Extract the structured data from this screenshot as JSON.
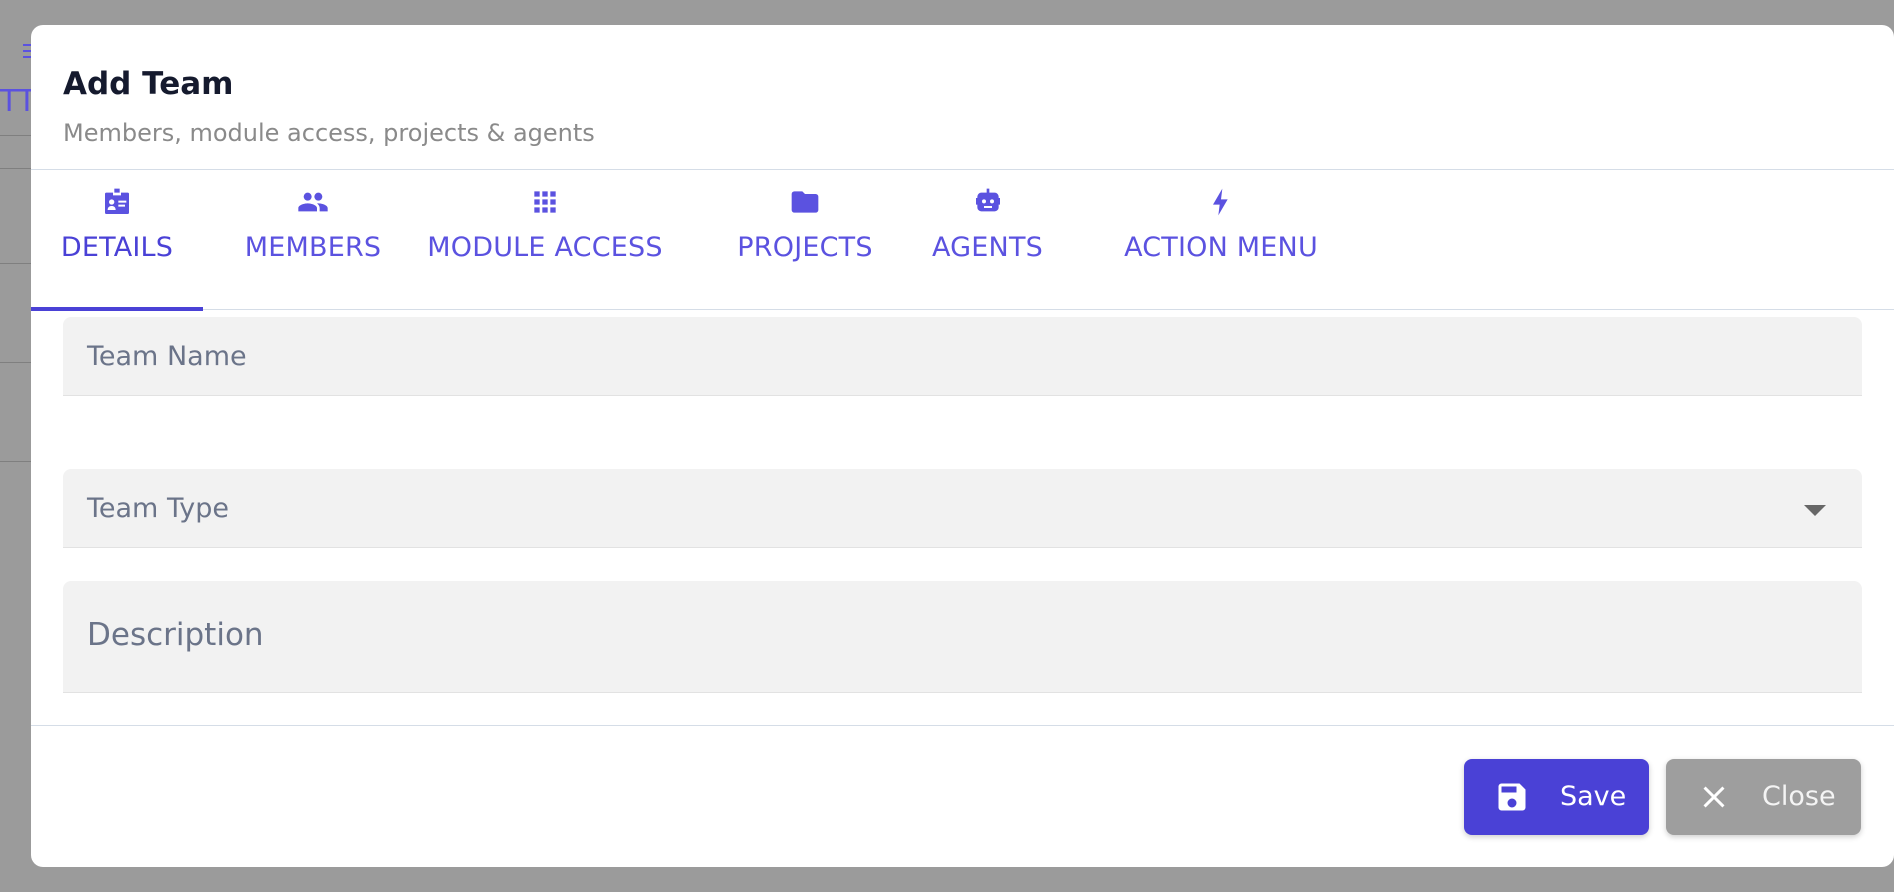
{
  "background": {
    "fragment_text": "TT",
    "fragment_icon": "list-icon"
  },
  "modal": {
    "title": "Add Team",
    "subtitle": "Members, module access, projects & agents"
  },
  "tabs": [
    {
      "label": "DETAILS",
      "icon": "id-badge-icon",
      "active": true
    },
    {
      "label": "MEMBERS",
      "icon": "people-icon",
      "active": false
    },
    {
      "label": "MODULE ACCESS",
      "icon": "apps-grid-icon",
      "active": false
    },
    {
      "label": "PROJECTS",
      "icon": "folder-icon",
      "active": false
    },
    {
      "label": "AGENTS",
      "icon": "robot-icon",
      "active": false
    },
    {
      "label": "ACTION MENU",
      "icon": "bolt-icon",
      "active": false
    }
  ],
  "form": {
    "team_name": {
      "placeholder": "Team Name",
      "value": ""
    },
    "team_type": {
      "placeholder": "Team Type",
      "value": ""
    },
    "description": {
      "placeholder": "Description",
      "value": ""
    }
  },
  "actions": {
    "save_label": "Save",
    "close_label": "Close"
  },
  "colors": {
    "accent": "#4a41d6",
    "tab_text": "#5b52e0",
    "close_button": "#9e9e9e",
    "overlay": "#9b9b9b"
  }
}
